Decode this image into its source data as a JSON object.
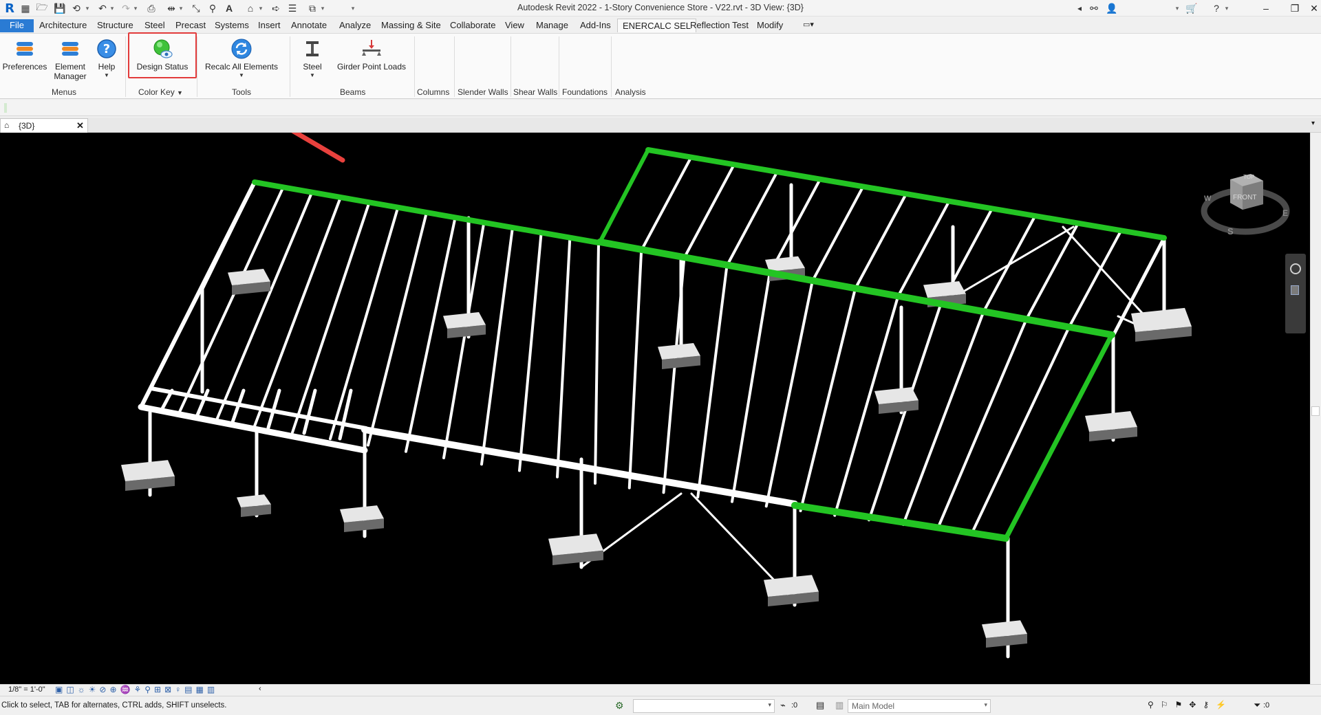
{
  "window": {
    "title": "Autodesk Revit 2022 - 1-Story Convenience Store - V22.rvt - 3D View: {3D}",
    "app_logo": "R",
    "text_tool": "A"
  },
  "tabs": [
    {
      "label": "File"
    },
    {
      "label": "Architecture"
    },
    {
      "label": "Structure"
    },
    {
      "label": "Steel"
    },
    {
      "label": "Precast"
    },
    {
      "label": "Systems"
    },
    {
      "label": "Insert"
    },
    {
      "label": "Annotate"
    },
    {
      "label": "Analyze"
    },
    {
      "label": "Massing & Site"
    },
    {
      "label": "Collaborate"
    },
    {
      "label": "View"
    },
    {
      "label": "Manage"
    },
    {
      "label": "Add-Ins"
    },
    {
      "label": "ENERCALC SEL"
    },
    {
      "label": "Reflection Test"
    },
    {
      "label": "Modify"
    }
  ],
  "ribbon": {
    "preferences": "Preferences",
    "element_manager_1": "Element",
    "element_manager_2": "Manager",
    "help": "Help",
    "design_status": "Design Status",
    "recalc_all": "Recalc All Elements",
    "steel": "Steel",
    "girder_point_loads": "Girder Point Loads",
    "panels": {
      "menus": "Menus",
      "color_key": "Color Key",
      "tools": "Tools",
      "beams": "Beams",
      "columns": "Columns",
      "slender_walls": "Slender Walls",
      "shear_walls": "Shear Walls",
      "foundations": "Foundations",
      "analysis": "Analysis"
    }
  },
  "view_tab": {
    "label": "{3D}",
    "close": "✕"
  },
  "viewcube": {
    "top": "TOP",
    "front": "FRONT",
    "w": "W",
    "s": "S",
    "e": "E"
  },
  "view_controls": {
    "scale": "1/8\" = 1'-0\""
  },
  "status": {
    "message": "Click to select, TAB for alternates, CTRL adds, SHIFT unselects.",
    "selection_count": ":0",
    "model": "Main Model",
    "filter_count": ":0"
  },
  "colors": {
    "accent_blue": "#2a7bd4",
    "highlight_red": "#e23a3a",
    "pass_green": "#23c423",
    "member_white": "#ffffff",
    "viewport_bg": "#000000"
  }
}
